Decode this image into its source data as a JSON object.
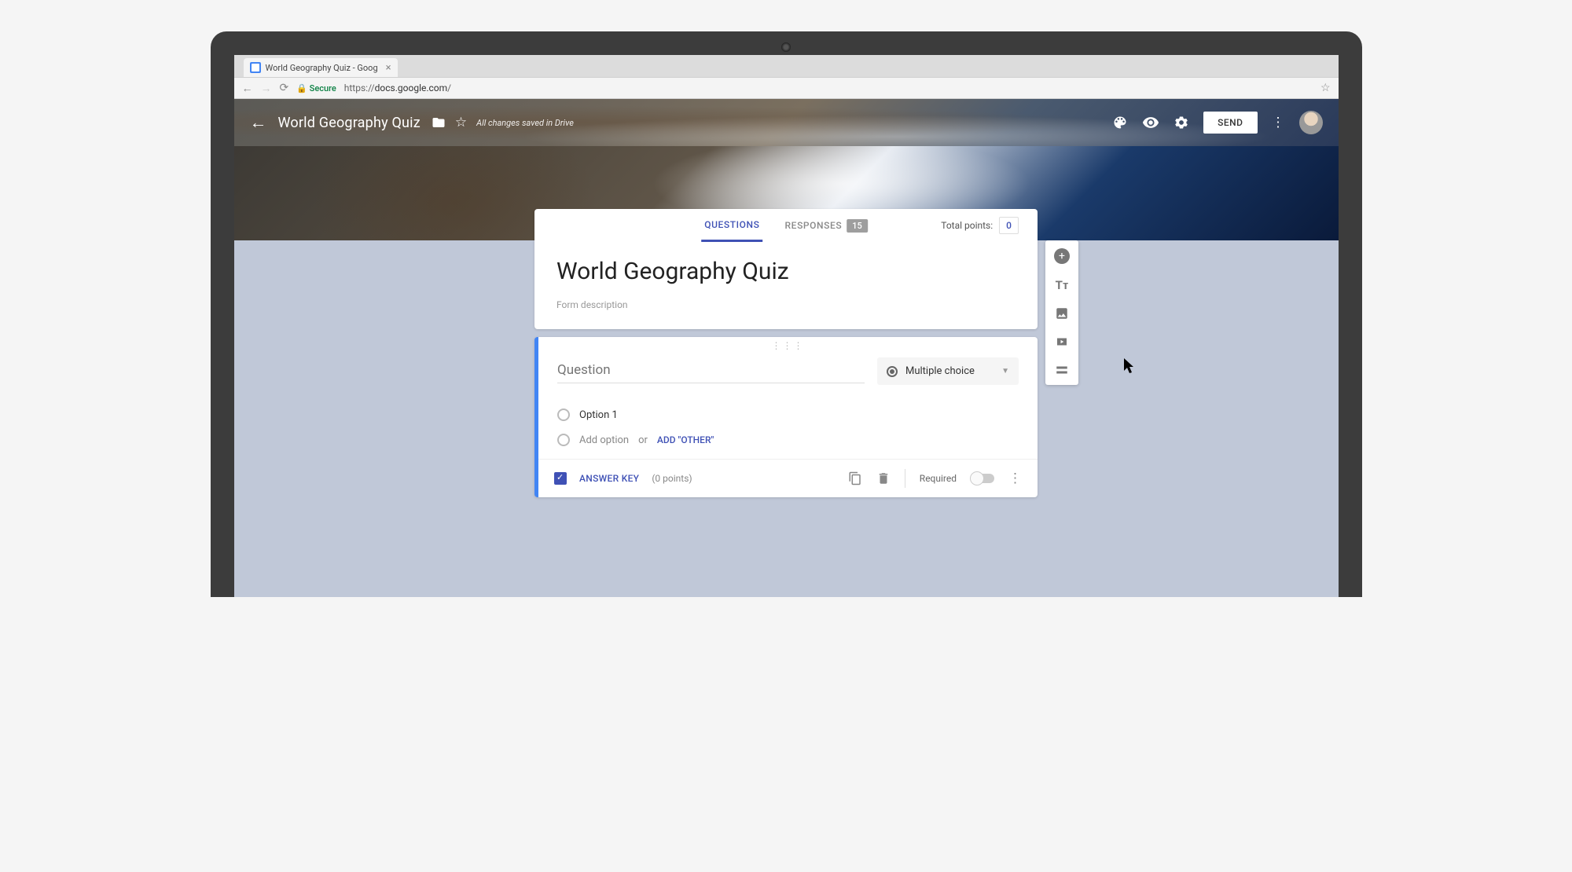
{
  "browser": {
    "tab_title": "World Geography Quiz - Goog",
    "secure_label": "Secure",
    "url_prefix": "https://",
    "url_host": "docs.google.com",
    "url_path": "/"
  },
  "header": {
    "title": "World Geography Quiz",
    "save_status": "All changes saved in Drive",
    "send_label": "SEND"
  },
  "tabs": {
    "questions": "QUESTIONS",
    "responses": "RESPONSES",
    "responses_count": "15",
    "total_points_label": "Total points:",
    "total_points_value": "0"
  },
  "form": {
    "title": "World Geography Quiz",
    "description_placeholder": "Form description"
  },
  "question": {
    "placeholder": "Question",
    "type_label": "Multiple choice",
    "option1": "Option 1",
    "add_option": "Add option",
    "or": "or",
    "add_other": "ADD \"OTHER\"",
    "answer_key": "ANSWER KEY",
    "points_text": "(0 points)",
    "required_label": "Required"
  }
}
